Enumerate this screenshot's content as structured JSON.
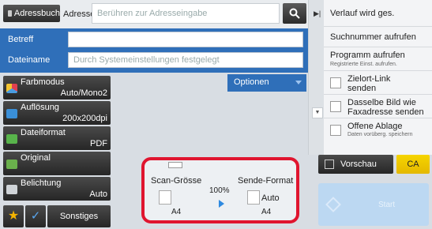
{
  "top": {
    "address_book_label": "Adressbuch",
    "address_label": "Adresse",
    "address_placeholder": "Berühren zur Adresseingabe"
  },
  "form": {
    "subject_label": "Betreff",
    "subject_value": "",
    "filename_label": "Dateiname",
    "filename_placeholder": "Durch Systemeinstellungen festgelegt"
  },
  "modes": [
    {
      "title": "Farbmodus",
      "value": "Auto/Mono2",
      "icon": "color-mode-icon",
      "color": "#e04050"
    },
    {
      "title": "Auflösung",
      "value": "200x200dpi",
      "icon": "resolution-icon",
      "color": "#3a8fd8"
    },
    {
      "title": "Dateiformat",
      "value": "PDF",
      "icon": "file-format-icon",
      "color": "#58b44b"
    },
    {
      "title": "Original",
      "value": "",
      "icon": "original-icon",
      "color": "#6ab04c"
    },
    {
      "title": "Belichtung",
      "value": "Auto",
      "icon": "exposure-icon",
      "color": "#d0d4d8"
    }
  ],
  "options_label": "Optionen",
  "bottom": {
    "others_label": "Sonstiges"
  },
  "scan": {
    "scan_size_label": "Scan-Grösse",
    "send_format_label": "Sende-Format",
    "percent": "100%",
    "scan_size_value": "A4",
    "send_auto": "Auto",
    "send_value": "A4"
  },
  "right_panel": {
    "items": [
      {
        "main": "Verlauf wird ges."
      },
      {
        "main": "Suchnummer aufrufen"
      },
      {
        "main": "Programm aufrufen",
        "sub": "Registrierte Einst. aufrufen."
      }
    ],
    "checks": [
      {
        "line1": "Zielort-Link",
        "line2": "senden"
      },
      {
        "line1": "Dasselbe Bild wie",
        "line2": "Faxadresse senden"
      },
      {
        "line1": "Offene Ablage",
        "sub": "Daten vorüberg. speichern"
      }
    ]
  },
  "preview_label": "Vorschau",
  "ca_label": "CA",
  "start_label": "Start",
  "colors": {
    "blue_accent": "#2f6fb9",
    "highlight_red": "#e0152f",
    "ca_yellow": "#f6d500"
  }
}
